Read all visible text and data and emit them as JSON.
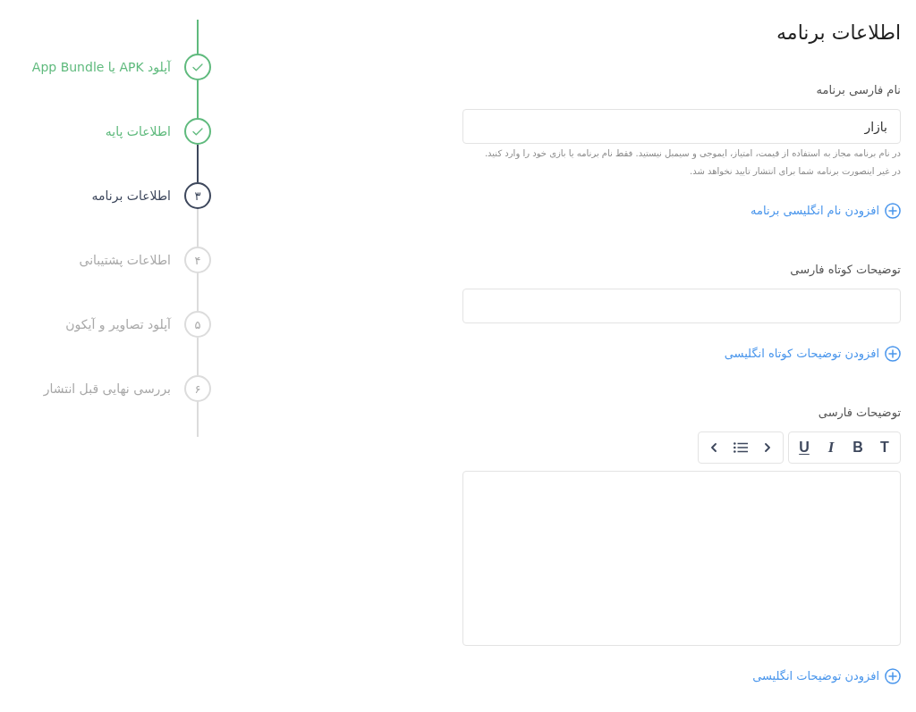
{
  "steps": [
    {
      "label": "آپلود APK یا App Bundle",
      "completed": true,
      "selected": false
    },
    {
      "label": "اطلاعات پایه",
      "completed": true,
      "selected": false
    },
    {
      "label": "اطلاعات برنامه",
      "completed": false,
      "selected": true,
      "number": "۳"
    },
    {
      "label": "اطلاعات پشتیبانی",
      "completed": false,
      "selected": false,
      "number": "۴"
    },
    {
      "label": "آپلود تصاویر و آیکون",
      "completed": false,
      "selected": false,
      "number": "۵"
    },
    {
      "label": "بررسی نهایی قبل انتشار",
      "completed": false,
      "selected": false,
      "number": "۶"
    }
  ],
  "form": {
    "title": "اطلاعات برنامه",
    "sections": [
      {
        "kind": "input",
        "label": "نام فارسی برنامه",
        "value": "بازار",
        "help": [
          "در نام برنامه مجاز به استفاده از قیمت، امتیاز، ایموجی و سیمبل نیستید. فقط نام برنامه یا بازی خود را وارد کنید.",
          "در غیر اینصورت برنامه شما برای انتشار تایید نخواهد شد."
        ],
        "link": "افزودن نام انگلیسی برنامه"
      },
      {
        "kind": "input",
        "label": "توضیحات کوتاه فارسی",
        "link": "افزودن توضیحات کوتاه انگلیسی"
      },
      {
        "kind": "editor",
        "label": "توضیحات فارسی",
        "toolbar": [
          {
            "buttons": [
              {
                "kind": "heading",
                "label": "T"
              },
              {
                "kind": "bold",
                "label": "B"
              },
              {
                "kind": "italic",
                "label": "I"
              },
              {
                "kind": "underline",
                "label": "U"
              }
            ]
          },
          {
            "buttons": [
              {
                "kind": "right"
              },
              {
                "kind": "list"
              },
              {
                "kind": "left"
              }
            ]
          }
        ],
        "link": "افزودن توضیحات انگلیسی"
      }
    ]
  }
}
